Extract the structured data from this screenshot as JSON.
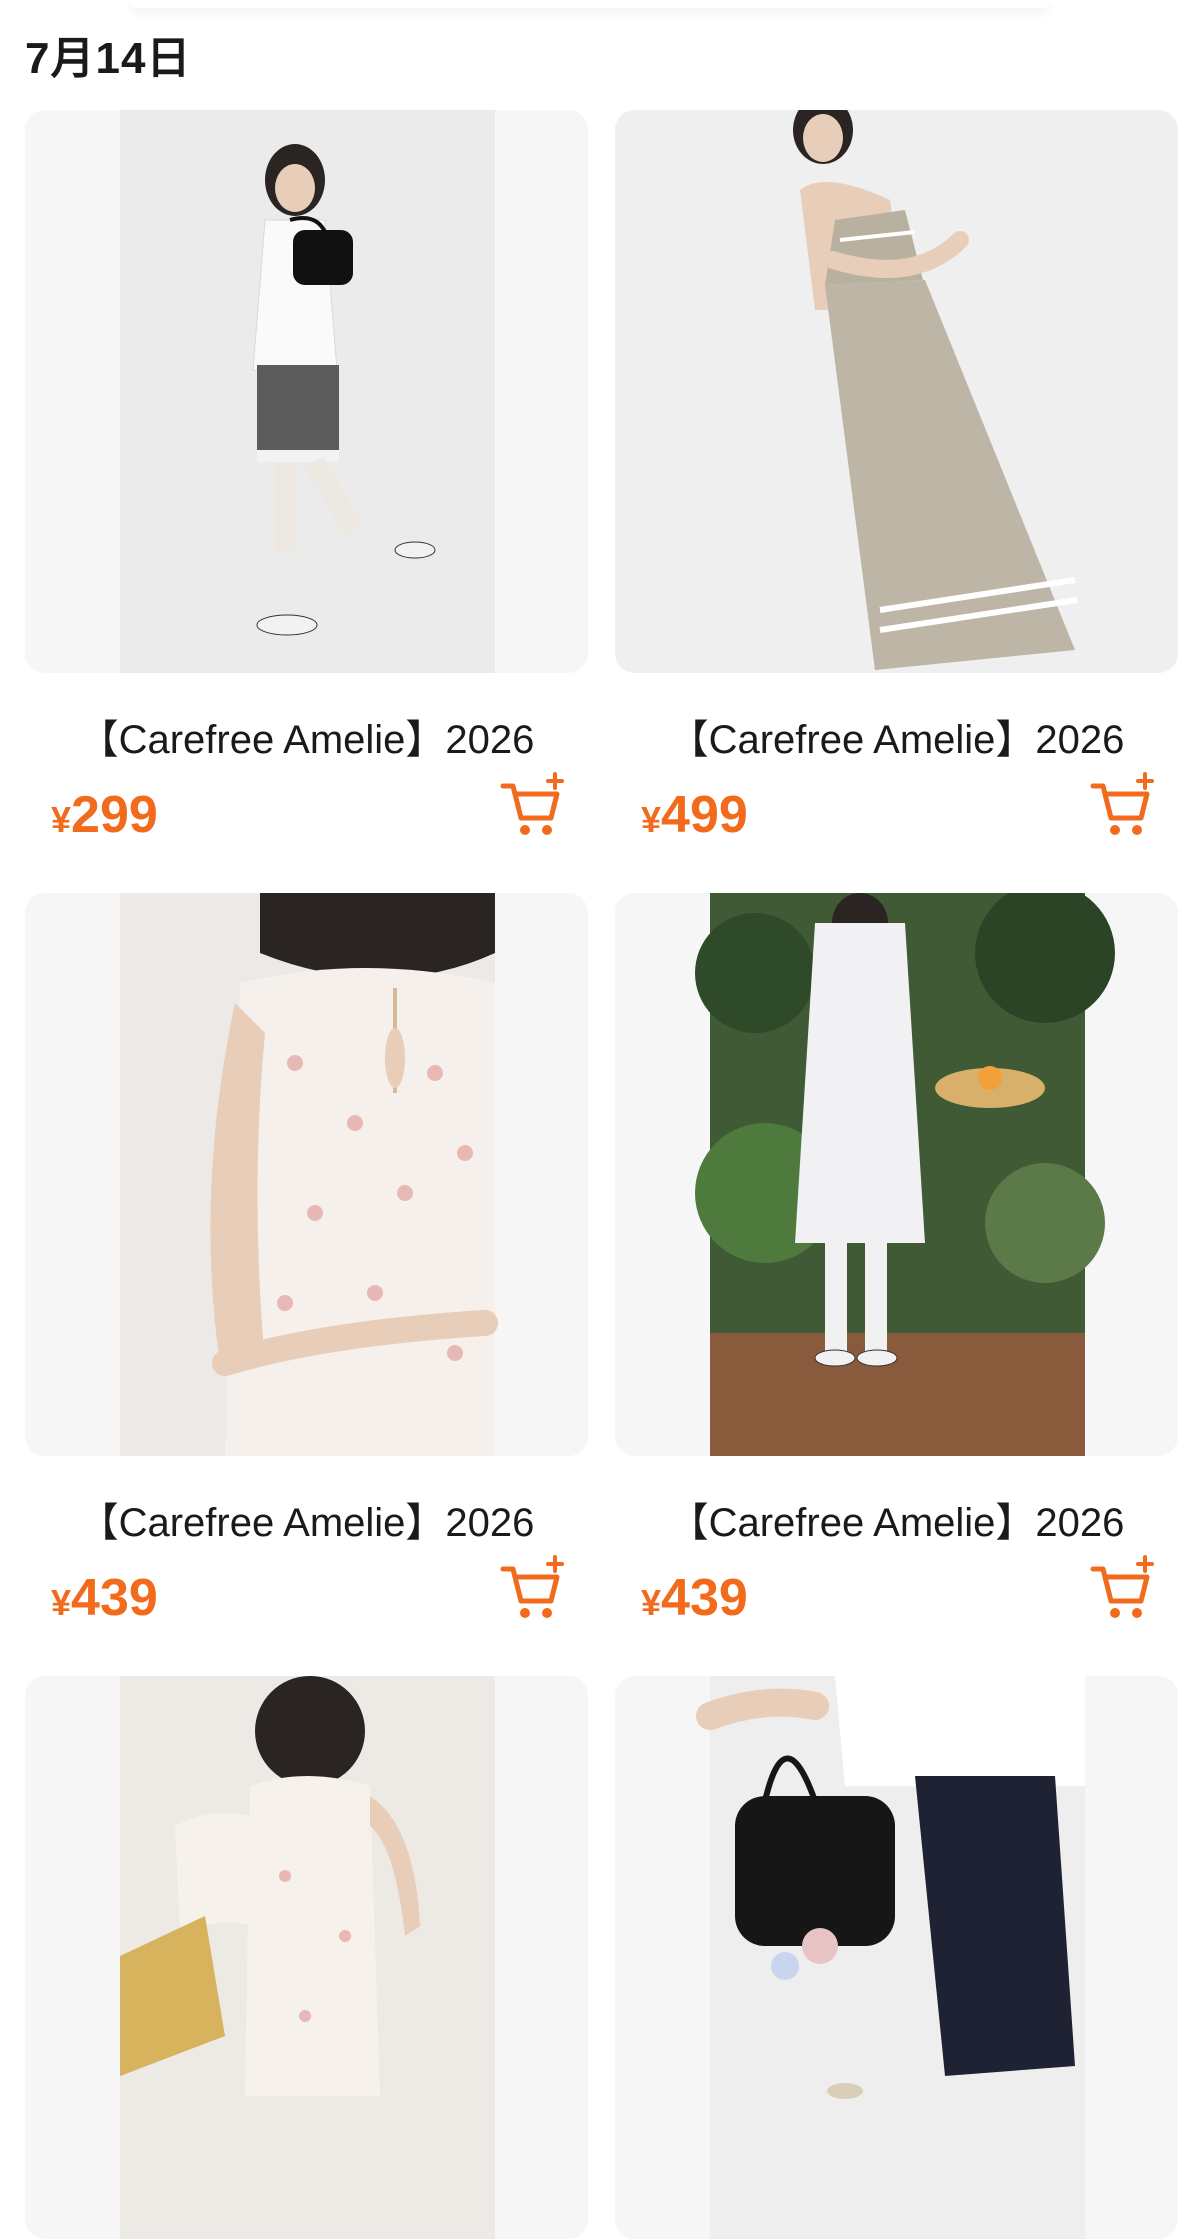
{
  "date_header": "7月14日",
  "colors": {
    "accent": "#f26b1d",
    "text": "#1a1a1a",
    "card_bg": "#f4f4f4"
  },
  "products": [
    {
      "title": "【Carefree Amelie】2026",
      "currency": "¥",
      "price": "299",
      "cart_icon": "add-to-cart-icon"
    },
    {
      "title": "【Carefree Amelie】2026",
      "currency": "¥",
      "price": "499",
      "cart_icon": "add-to-cart-icon"
    },
    {
      "title": "【Carefree Amelie】2026",
      "currency": "¥",
      "price": "439",
      "cart_icon": "add-to-cart-icon"
    },
    {
      "title": "【Carefree Amelie】2026",
      "currency": "¥",
      "price": "439",
      "cart_icon": "add-to-cart-icon"
    },
    {
      "title": "",
      "currency": "",
      "price": "",
      "cart_icon": ""
    },
    {
      "title": "",
      "currency": "",
      "price": "",
      "cart_icon": ""
    }
  ]
}
